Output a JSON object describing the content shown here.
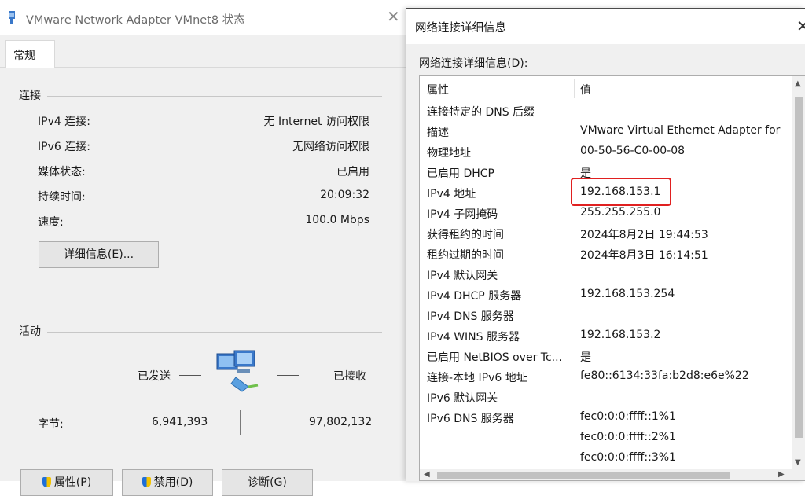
{
  "left_window": {
    "title": "VMware Network Adapter VMnet8 状态",
    "close": "✕",
    "tab": "常规",
    "connection": {
      "heading": "连接",
      "rows": [
        {
          "label": "IPv4 连接:",
          "value": "无 Internet 访问权限"
        },
        {
          "label": "IPv6 连接:",
          "value": "无网络访问权限"
        },
        {
          "label": "媒体状态:",
          "value": "已启用"
        },
        {
          "label": "持续时间:",
          "value": "20:09:32"
        },
        {
          "label": "速度:",
          "value": "100.0 Mbps"
        }
      ],
      "details_button": "详细信息(E)..."
    },
    "activity": {
      "heading": "活动",
      "sent_label": "已发送",
      "received_label": "已接收",
      "bytes_label": "字节:",
      "sent_bytes": "6,941,393",
      "received_bytes": "97,802,132"
    },
    "buttons": {
      "properties": "属性(P)",
      "disable": "禁用(D)",
      "diagnose": "诊断(G)"
    }
  },
  "right_window": {
    "title": "网络连接详细信息",
    "close": "✕",
    "list_label_prefix": "网络连接详细信息(",
    "list_label_key": "D",
    "list_label_suffix": "):",
    "columns": {
      "property": "属性",
      "value": "值"
    },
    "rows": [
      {
        "property": "连接特定的 DNS 后缀",
        "value": ""
      },
      {
        "property": "描述",
        "value": "VMware Virtual Ethernet Adapter for"
      },
      {
        "property": "物理地址",
        "value": "00-50-56-C0-00-08"
      },
      {
        "property": "已启用 DHCP",
        "value": "是"
      },
      {
        "property": "IPv4 地址",
        "value": "192.168.153.1"
      },
      {
        "property": "IPv4 子网掩码",
        "value": "255.255.255.0"
      },
      {
        "property": "获得租约的时间",
        "value": "2024年8月2日 19:44:53"
      },
      {
        "property": "租约过期的时间",
        "value": "2024年8月3日 16:14:51"
      },
      {
        "property": "IPv4 默认网关",
        "value": ""
      },
      {
        "property": "IPv4 DHCP 服务器",
        "value": "192.168.153.254"
      },
      {
        "property": "IPv4 DNS 服务器",
        "value": ""
      },
      {
        "property": "IPv4 WINS 服务器",
        "value": "192.168.153.2"
      },
      {
        "property": "已启用 NetBIOS over Tc...",
        "value": "是"
      },
      {
        "property": "连接-本地 IPv6 地址",
        "value": "fe80::6134:33fa:b2d8:e6e%22"
      },
      {
        "property": "IPv6 默认网关",
        "value": ""
      },
      {
        "property": "IPv6 DNS 服务器",
        "value": "fec0:0:0:ffff::1%1"
      },
      {
        "property": "",
        "value": "fec0:0:0:ffff::2%1"
      },
      {
        "property": "",
        "value": "fec0:0:0:ffff::3%1"
      }
    ]
  },
  "colors": {
    "highlight_border": "#e02020",
    "window_bg": "#f0f0f0"
  }
}
